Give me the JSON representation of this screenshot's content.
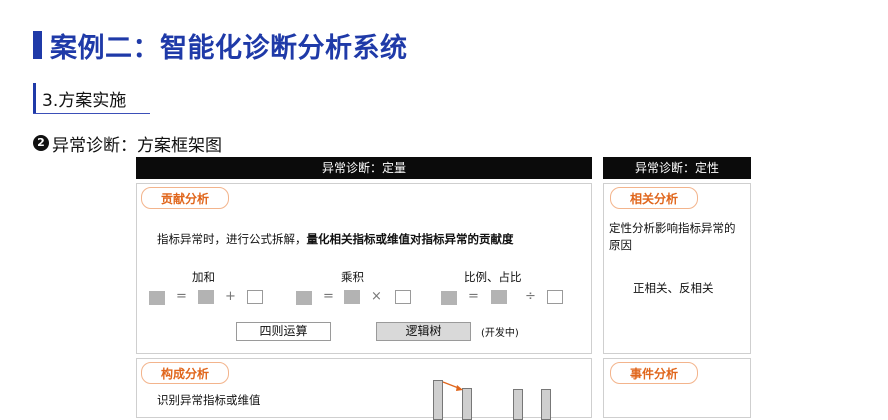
{
  "header": {
    "title": "案例二：智能化诊断分析系统",
    "section": "3.方案实施"
  },
  "diagram": {
    "step_number": "2",
    "title": "异常诊断：方案框架图",
    "quant_header": "异常诊断：定量",
    "qual_header": "异常诊断：定性",
    "contribution": {
      "tag": "贡献分析",
      "desc_normal": "指标异常时，进行公式拆解，",
      "desc_bold": "量化相关指标或维值对指标异常的贡献度",
      "formulas": [
        {
          "label": "加和",
          "op1": "=",
          "op2": "+"
        },
        {
          "label": "乘积",
          "op1": "=",
          "op2": "×"
        },
        {
          "label": "比例、占比",
          "op1": "=",
          "op2": "÷"
        }
      ],
      "btn_arith": "四则运算",
      "btn_logic": "逻辑树",
      "dev_note": "(开发中)"
    },
    "correlation": {
      "tag": "相关分析",
      "desc": "定性分析影响指标异常的原因",
      "detail": "正相关、反相关"
    },
    "composition": {
      "tag": "构成分析",
      "desc": "识别异常指标或维值"
    },
    "event": {
      "tag": "事件分析"
    }
  }
}
